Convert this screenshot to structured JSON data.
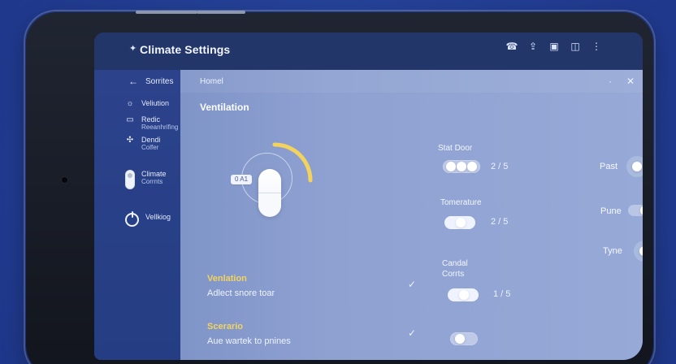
{
  "app": {
    "title": "Climate Settings"
  },
  "sidebar": {
    "back_label": "Sorrites",
    "items": [
      {
        "title": "Veliution",
        "subtitle": ""
      },
      {
        "title": "Redic",
        "subtitle": "Reeanhrifing"
      },
      {
        "title": "Dendi",
        "subtitle": "Colfer"
      },
      {
        "title": "Climate",
        "subtitle": "Corrnts"
      },
      {
        "title": "Vellkiog",
        "subtitle": ""
      }
    ]
  },
  "content": {
    "breadcrumb": "Homel",
    "section_title": "Ventilation",
    "dial_label": "0 A1",
    "left_blocks": [
      {
        "title": "Venlation",
        "subtitle": "Adlect snore toar"
      },
      {
        "title": "Scerario",
        "subtitle": "Aue wartek to pnines"
      }
    ],
    "controls": [
      {
        "label": "Stat Door",
        "value": "2 / 5"
      },
      {
        "label": "Tomerature",
        "value": "2 / 5"
      },
      {
        "label_line1": "Candal",
        "label_line2": "Corrts",
        "value": "1 / 5"
      },
      {
        "label": "",
        "value": ""
      }
    ],
    "right_options": [
      {
        "label": "Past"
      },
      {
        "label": "Pune"
      },
      {
        "label": "Tyne"
      }
    ]
  },
  "colors": {
    "accent": "#f3d35d",
    "screen_bg": "#2f4a91",
    "sidebar_bg": "#2c438c",
    "content_bg": "#8ea1d1"
  },
  "icons": {
    "title": "sparkle-icon",
    "actions": [
      "phone-icon",
      "share-icon",
      "book-icon",
      "grid-icon",
      "more-icon"
    ],
    "sidebar": [
      "back-arrow-icon",
      "sun-icon",
      "rectangle-icon",
      "fan-icon",
      "toggle-icon",
      "power-icon"
    ],
    "header": [
      "close-icon"
    ]
  }
}
